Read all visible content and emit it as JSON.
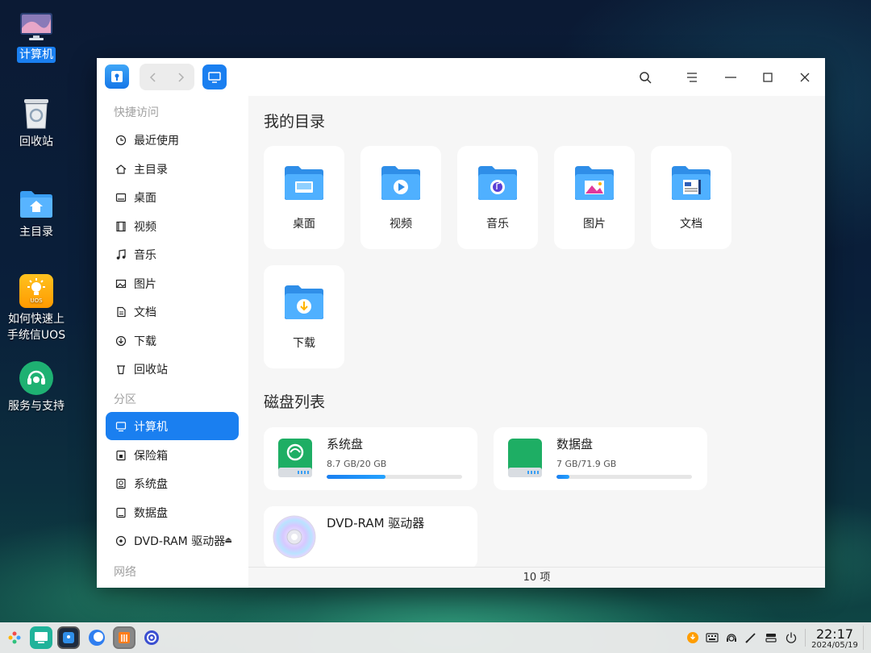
{
  "desktop": {
    "icons": [
      {
        "label": "计算机"
      },
      {
        "label": "回收站"
      },
      {
        "label": "主目录"
      },
      {
        "label_line1": "如何快速上",
        "label_line2": "手统信UOS",
        "badge": "UOS"
      },
      {
        "label": "服务与支持"
      }
    ]
  },
  "window": {
    "sidebar": {
      "quick_access_header": "快捷访问",
      "quick_items": [
        {
          "label": "最近使用",
          "icon": "clock-icon"
        },
        {
          "label": "主目录",
          "icon": "home-icon"
        },
        {
          "label": "桌面",
          "icon": "desktop-icon"
        },
        {
          "label": "视频",
          "icon": "film-icon"
        },
        {
          "label": "音乐",
          "icon": "music-icon"
        },
        {
          "label": "图片",
          "icon": "image-icon"
        },
        {
          "label": "文档",
          "icon": "document-icon"
        },
        {
          "label": "下载",
          "icon": "download-icon"
        },
        {
          "label": "回收站",
          "icon": "trash-icon"
        }
      ],
      "partition_header": "分区",
      "partition_items": [
        {
          "label": "计算机",
          "icon": "computer-icon",
          "active": true
        },
        {
          "label": "保险箱",
          "icon": "vault-icon"
        },
        {
          "label": "系统盘",
          "icon": "system-disk-icon"
        },
        {
          "label": "数据盘",
          "icon": "data-disk-icon"
        },
        {
          "label": "DVD-RAM 驱动器",
          "icon": "dvd-icon"
        }
      ],
      "network_header": "网络"
    },
    "content": {
      "my_dirs_title": "我的目录",
      "dirs": [
        {
          "label": "桌面"
        },
        {
          "label": "视频"
        },
        {
          "label": "音乐"
        },
        {
          "label": "图片"
        },
        {
          "label": "文档"
        },
        {
          "label": "下载"
        }
      ],
      "disks_title": "磁盘列表",
      "disks": [
        {
          "name": "系统盘",
          "size": "8.7 GB/20 GB",
          "usage": 0.435
        },
        {
          "name": "数据盘",
          "size": "7 GB/71.9 GB",
          "usage": 0.097
        },
        {
          "name": "DVD-RAM 驱动器"
        }
      ]
    },
    "status": "10 项"
  },
  "taskbar": {
    "time": "22:17",
    "date": "2024/05/19"
  },
  "colors": {
    "accent": "#1a7ff0",
    "folder_blue": "#2f9bf0",
    "disk_green": "#1fb56a"
  }
}
